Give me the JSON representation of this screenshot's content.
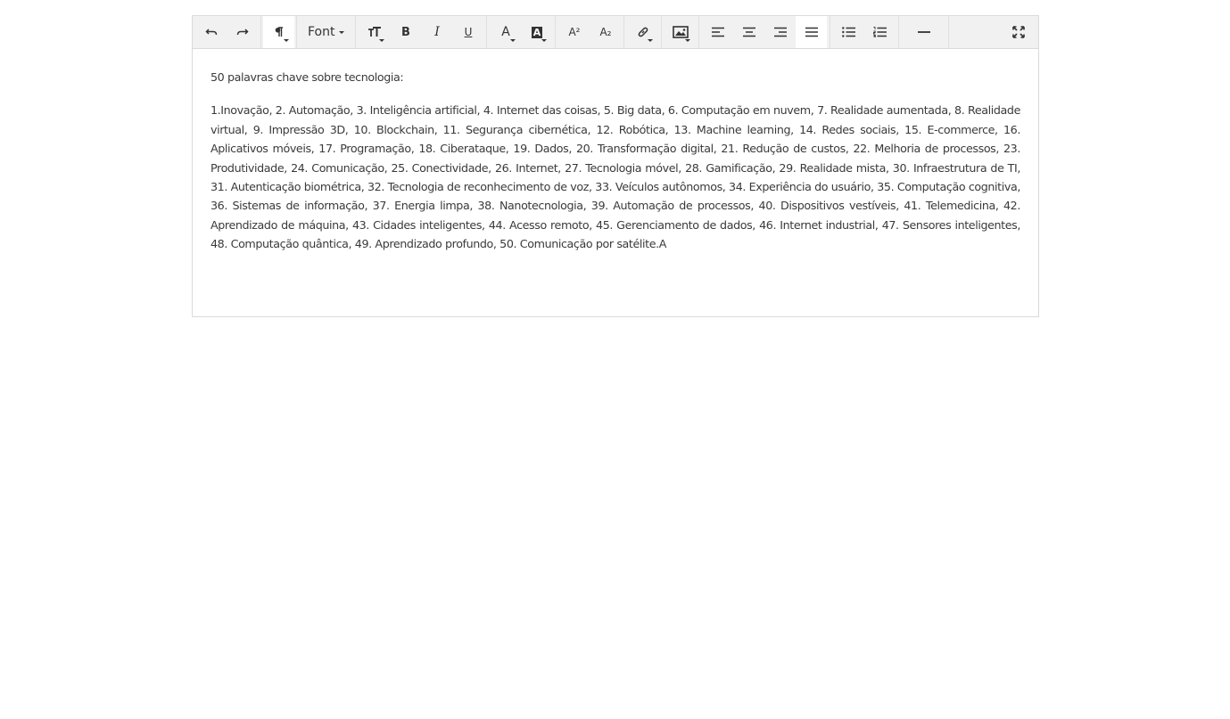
{
  "toolbar": {
    "font_label": "Font",
    "buttons": {
      "undo": "undo-icon",
      "redo": "redo-icon",
      "paragraph": "paragraph-icon",
      "font_size": "font-size-icon",
      "bold": "B",
      "italic": "I",
      "underline": "U",
      "font_color": "A",
      "highlight_color": "A",
      "superscript": "A²",
      "subscript": "A₂",
      "link": "link-icon",
      "image": "image-icon",
      "align_left": "align-left-icon",
      "align_center": "align-center-icon",
      "align_right": "align-right-icon",
      "align_justify": "align-justify-icon",
      "bullet_list": "bullet-list-icon",
      "numbered_list": "numbered-list-icon",
      "horizontal_rule": "horizontal-rule-icon",
      "fullscreen": "fullscreen-icon"
    }
  },
  "content": {
    "heading": "50 palavras chave sobre tecnologia:",
    "body": "1.Inovação, 2. Automação, 3. Inteligência artificial, 4. Internet das coisas, 5. Big data, 6. Computação em nuvem, 7. Realidade aumentada, 8. Realidade virtual, 9. Impressão 3D, 10. Blockchain, 11. Segurança cibernética, 12. Robótica, 13. Machine learning, 14. Redes sociais, 15. E-commerce, 16. Aplicativos móveis, 17. Programação, 18. Ciberataque, 19. Dados, 20. Transformação digital, 21. Redução de custos, 22. Melhoria de processos, 23. Produtividade, 24. Comunicação, 25. Conectividade, 26. Internet, 27. Tecnologia móvel, 28. Gamificação, 29. Realidade mista, 30. Infraestrutura de TI, 31. Autenticação biométrica, 32. Tecnologia de reconhecimento de voz, 33. Veículos autônomos, 34. Experiência do usuário, 35. Computação cognitiva, 36. Sistemas de informação, 37. Energia limpa, 38. Nanotecnologia, 39. Automação de processos, 40. Dispositivos vestíveis, 41. Telemedicina, 42. Aprendizado de máquina, 43. Cidades inteligentes, 44. Acesso remoto, 45. Gerenciamento de dados, 46. Internet industrial, 47. Sensores inteligentes, 48. Computação quântica, 49. Aprendizado profundo, 50. Comunicação por satélite.A"
  },
  "colors": {
    "toolbar_bg": "#f1f1f1",
    "border": "#dadada",
    "text": "#3a3a3a"
  }
}
